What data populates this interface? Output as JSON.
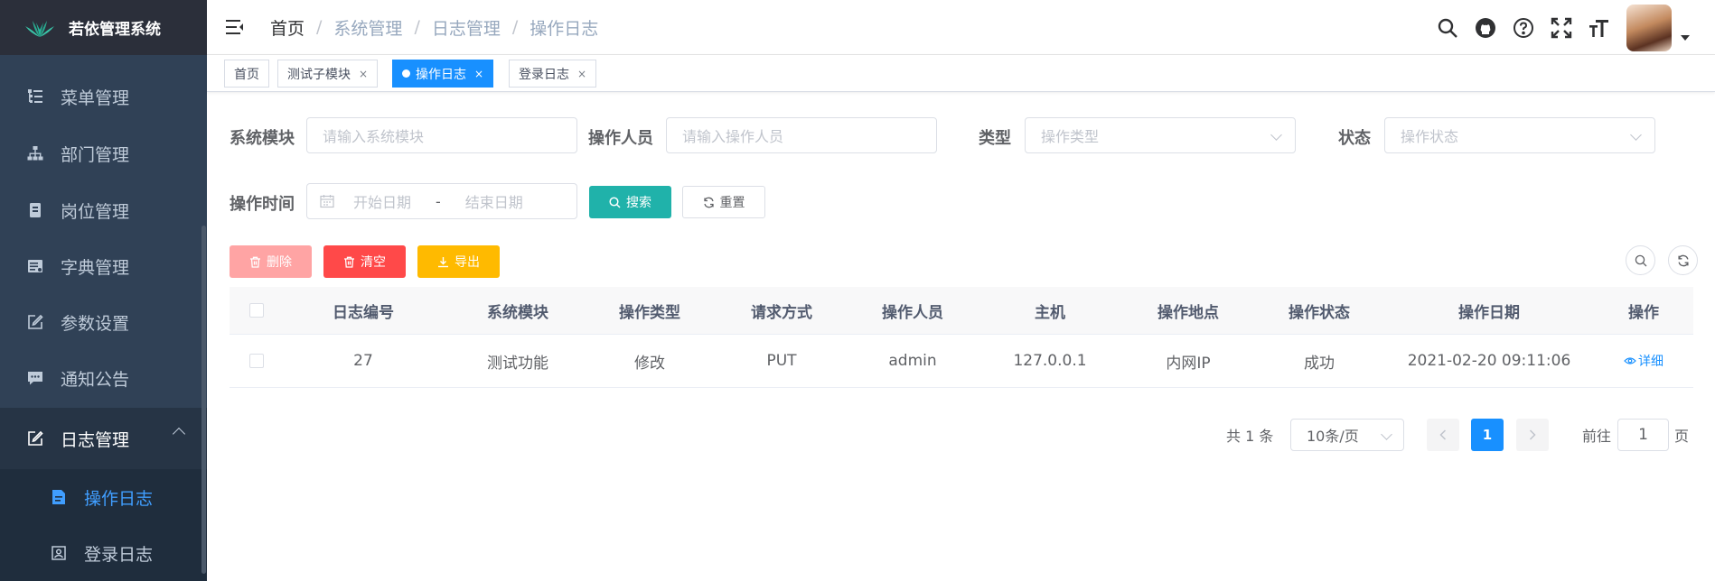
{
  "app": {
    "title": "若依管理系统"
  },
  "colors": {
    "sidebar": "#304156",
    "accent": "#1890ff",
    "primary_btn": "#20b2aa",
    "danger": "#ff4949",
    "warning": "#ffba00"
  },
  "sidebar": {
    "items": [
      {
        "label": "菜单管理",
        "icon": "tree-table-icon"
      },
      {
        "label": "部门管理",
        "icon": "org-tree-icon"
      },
      {
        "label": "岗位管理",
        "icon": "post-icon"
      },
      {
        "label": "字典管理",
        "icon": "dict-icon"
      },
      {
        "label": "参数设置",
        "icon": "edit-icon"
      },
      {
        "label": "通知公告",
        "icon": "message-icon"
      },
      {
        "label": "日志管理",
        "icon": "log-icon"
      }
    ],
    "sub_items": [
      {
        "label": "操作日志",
        "icon": "form-icon"
      },
      {
        "label": "登录日志",
        "icon": "logininfor-icon"
      }
    ]
  },
  "breadcrumb": [
    "首页",
    "系统管理",
    "日志管理",
    "操作日志"
  ],
  "breadcrumb_sep": "/",
  "tags": [
    {
      "label": "首页"
    },
    {
      "label": "测试子模块",
      "close": "×"
    },
    {
      "label": "操作日志",
      "close": "×"
    },
    {
      "label": "登录日志",
      "close": "×"
    }
  ],
  "search": {
    "module_label": "系统模块",
    "module_placeholder": "请输入系统模块",
    "user_label": "操作人员",
    "user_placeholder": "请输入操作人员",
    "type_label": "类型",
    "type_placeholder": "操作类型",
    "status_label": "状态",
    "status_placeholder": "操作状态",
    "time_label": "操作时间",
    "start_placeholder": "开始日期",
    "range_sep": "-",
    "end_placeholder": "结束日期",
    "search_btn": "搜索",
    "reset_btn": "重置"
  },
  "toolbar": {
    "delete": "删除",
    "clear": "清空",
    "export": "导出"
  },
  "table": {
    "headers": [
      "日志编号",
      "系统模块",
      "操作类型",
      "请求方式",
      "操作人员",
      "主机",
      "操作地点",
      "操作状态",
      "操作日期",
      "操作"
    ],
    "rows": [
      {
        "id": "27",
        "module": "测试功能",
        "type": "修改",
        "method": "PUT",
        "user": "admin",
        "host": "127.0.0.1",
        "location": "内网IP",
        "status": "成功",
        "date": "2021-02-20 09:11:06",
        "action": "详细"
      }
    ]
  },
  "pagination": {
    "total": "共 1 条",
    "size": "10条/页",
    "current": "1",
    "goto_label": "前往",
    "goto_value": "1",
    "page_suffix": "页"
  }
}
